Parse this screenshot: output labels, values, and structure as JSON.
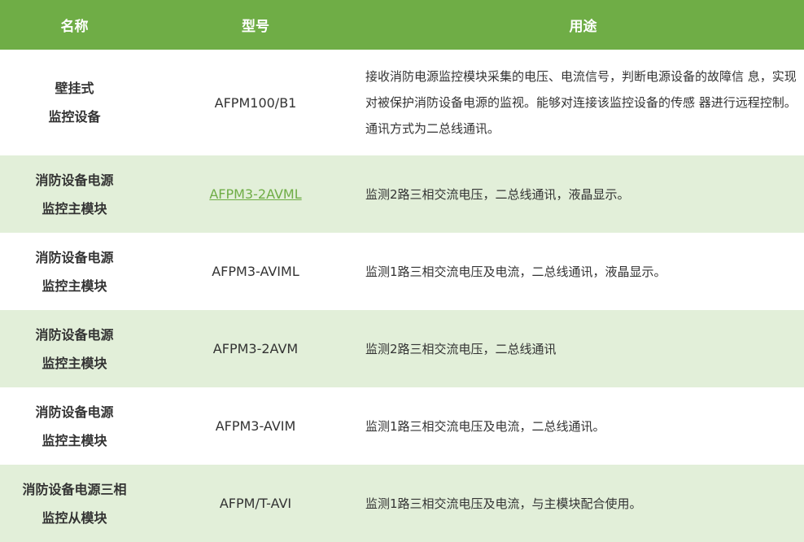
{
  "headers": {
    "name": "名称",
    "model": "型号",
    "use": "用途"
  },
  "rows": [
    {
      "name_lines": [
        "壁挂式",
        "监控设备"
      ],
      "model": "AFPM100/B1",
      "model_link": false,
      "use": "接收消防电源监控模块采集的电压、电流信号，判断电源设备的故障信 息，实现对被保护消防设备电源的监视。能够对连接该监控设备的传感 器进行远程控制。通讯方式为二总线通讯。"
    },
    {
      "name_lines": [
        "消防设备电源",
        "监控主模块"
      ],
      "model": "AFPM3-2AVML",
      "model_link": true,
      "use": "监测2路三相交流电压，二总线通讯，液晶显示。"
    },
    {
      "name_lines": [
        "消防设备电源",
        "监控主模块"
      ],
      "model": "AFPM3-AVIML",
      "model_link": false,
      "use": "监测1路三相交流电压及电流，二总线通讯，液晶显示。"
    },
    {
      "name_lines": [
        "消防设备电源",
        "监控主模块"
      ],
      "model": "AFPM3-2AVM",
      "model_link": false,
      "use": "监测2路三相交流电压，二总线通讯"
    },
    {
      "name_lines": [
        "消防设备电源",
        "监控主模块"
      ],
      "model": "AFPM3-AVIM",
      "model_link": false,
      "use": "监测1路三相交流电压及电流，二总线通讯。"
    },
    {
      "name_lines": [
        "消防设备电源三相",
        "监控从模块"
      ],
      "model": "AFPM/T-AVI",
      "model_link": false,
      "use": "监测1路三相交流电压及电流，与主模块配合使用。"
    }
  ],
  "colors": {
    "header_bg": "#6fad46",
    "stripe_bg": "#e2efd9",
    "link": "#6fad46",
    "text": "#333333"
  }
}
